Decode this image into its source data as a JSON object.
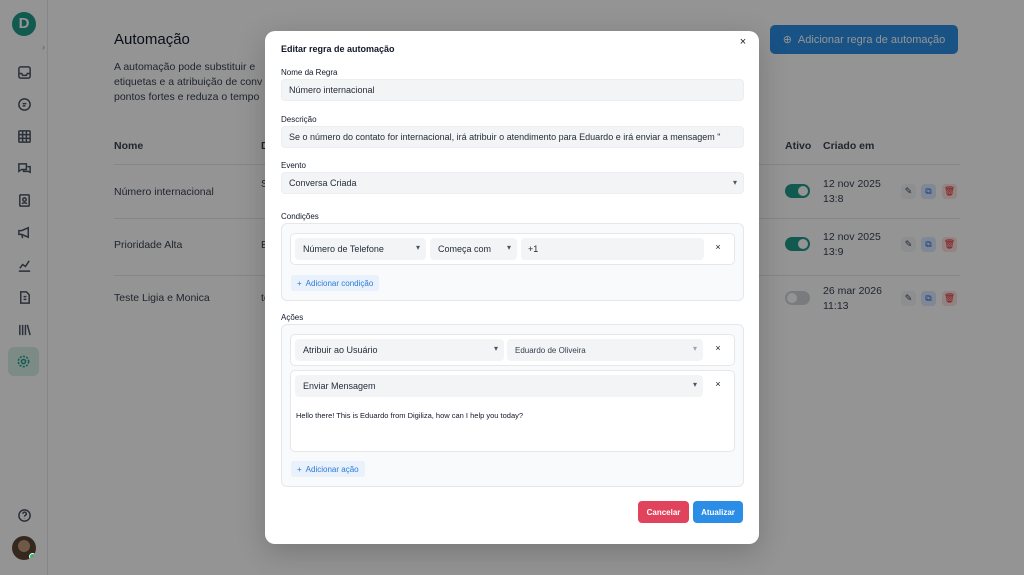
{
  "app": {
    "logo_letter": "D",
    "page_title": "Automação",
    "page_description": "A automação pode substituir e etiquetas e a atribuição de conv pontos fortes e reduza o tempo",
    "add_rule_button": "Adicionar regra de automação",
    "columns": {
      "name": "Nome",
      "desc": "D",
      "active": "Ativo",
      "created": "Criado em"
    },
    "rows": [
      {
        "name": "Número internacional",
        "desc_fragment": "S",
        "active": true,
        "created": "12 nov 2025\n13:8"
      },
      {
        "name": "Prioridade Alta",
        "desc_fragment": "E",
        "active": true,
        "created": "12 nov 2025\n13:9"
      },
      {
        "name": "Teste Ligia e Monica",
        "desc_fragment": "te",
        "active": false,
        "created": "26 mar 2026\n11:13"
      }
    ],
    "sidebar_icons": [
      "inbox-icon",
      "chat-icon",
      "grid-icon",
      "messages-icon",
      "contacts-icon",
      "megaphone-icon",
      "chart-icon",
      "file-icon",
      "library-icon",
      "gear-icon"
    ],
    "colors": {
      "brand": "#1f9b8a",
      "primary": "#2b8de5",
      "danger": "#e0435b"
    }
  },
  "modal": {
    "title": "Editar regra de automação",
    "rule_name_label": "Nome da Regra",
    "rule_name_value": "Número internacional",
    "description_label": "Descrição",
    "description_value": "Se o número do contato for internacional, irá atribuir o atendimento para Eduardo e irá enviar a mensagem \"",
    "event_label": "Evento",
    "event_value": "Conversa Criada",
    "conditions_label": "Condições",
    "condition": {
      "attribute": "Número de Telefone",
      "operator": "Começa com",
      "value": "+1"
    },
    "add_condition": "Adicionar condição",
    "actions_label": "Ações",
    "action1": {
      "type": "Atribuir ao Usuário",
      "value": "Eduardo de Oliveira"
    },
    "action2": {
      "type": "Enviar Mensagem",
      "message": "Hello there! This is Eduardo from Digiliza, how can I help you today?"
    },
    "add_action": "Adicionar ação",
    "cancel": "Cancelar",
    "update": "Atualizar"
  }
}
